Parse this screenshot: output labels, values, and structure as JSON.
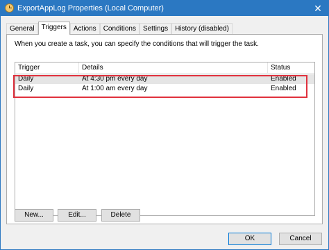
{
  "window": {
    "title": "ExportAppLog Properties (Local Computer)",
    "close_glyph": "✕",
    "accent_color": "#2b78c2"
  },
  "tabs": [
    {
      "label": "General"
    },
    {
      "label": "Triggers"
    },
    {
      "label": "Actions"
    },
    {
      "label": "Conditions"
    },
    {
      "label": "Settings"
    },
    {
      "label": "History (disabled)"
    }
  ],
  "active_tab": "Triggers",
  "panel": {
    "description": "When you create a task, you can specify the conditions that will trigger the task."
  },
  "triggers_list": {
    "columns": [
      "Trigger",
      "Details",
      "Status"
    ],
    "rows": [
      {
        "trigger": "Daily",
        "details": "At 4:30 pm every day",
        "status": "Enabled"
      },
      {
        "trigger": "Daily",
        "details": "At 1:00 am every day",
        "status": "Enabled"
      }
    ],
    "highlight_color": "#e0313d"
  },
  "list_buttons": {
    "new": "New...",
    "edit": "Edit...",
    "delete": "Delete"
  },
  "dialog_buttons": {
    "ok": "OK",
    "cancel": "Cancel"
  }
}
